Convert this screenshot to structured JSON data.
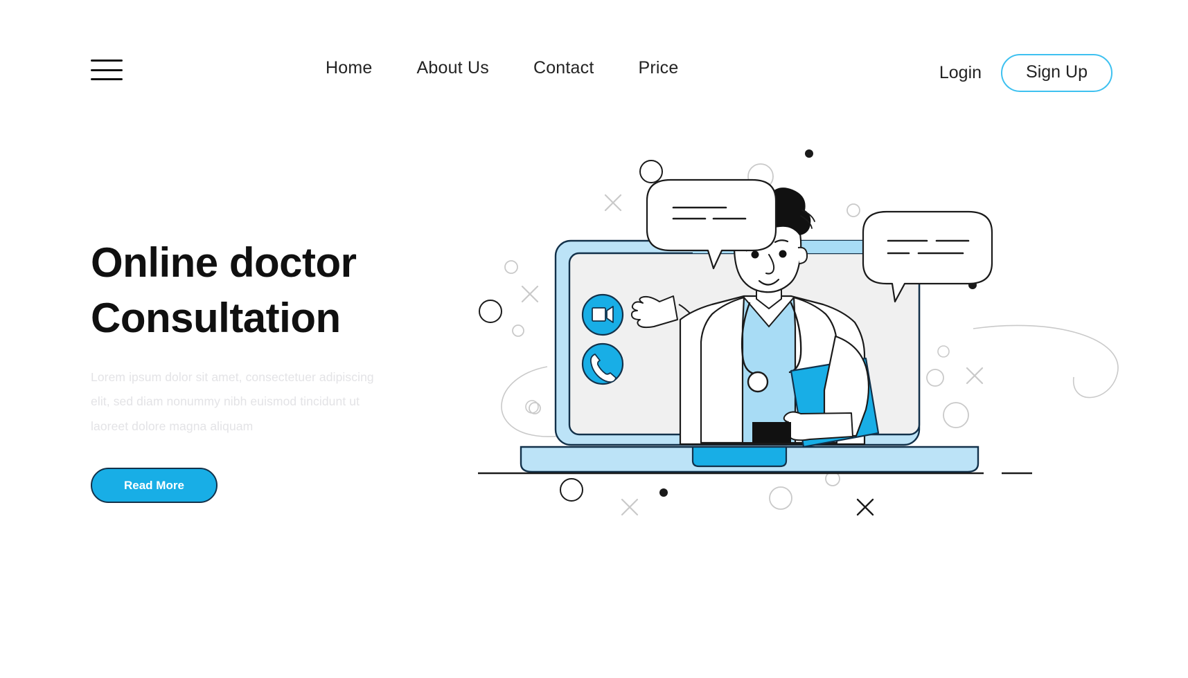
{
  "header": {
    "menu_icon": "hamburger-menu-icon",
    "nav": [
      {
        "label": "Home"
      },
      {
        "label": "About Us"
      },
      {
        "label": "Contact"
      },
      {
        "label": "Price"
      }
    ],
    "login_label": "Login",
    "signup_label": "Sign Up"
  },
  "hero": {
    "title_line1": "Online doctor",
    "title_line2": "Consultation",
    "paragraph": "Lorem ipsum dolor sit amet, consectetuer adipiscing elit, sed diam nonummy nibh euismod tincidunt ut laoreet dolore magna aliquam",
    "cta_label": "Read More"
  },
  "illustration": {
    "name": "online-doctor-consultation-illustration",
    "device": "laptop",
    "call_buttons": [
      {
        "icon": "video-camera-icon"
      },
      {
        "icon": "phone-call-icon"
      }
    ],
    "character": "doctor-with-clipboard",
    "speech_bubbles": 2
  },
  "colors": {
    "accent_blue": "#18AEE6",
    "light_blue": "#BCE3F7",
    "scrub_blue": "#A8DCF5",
    "outline_dark": "#12314a",
    "screen_gray": "#F0F0F0",
    "decor_gray": "#C9C9C9",
    "text_dark": "#232323",
    "muted_text": "#e3e3e6"
  }
}
